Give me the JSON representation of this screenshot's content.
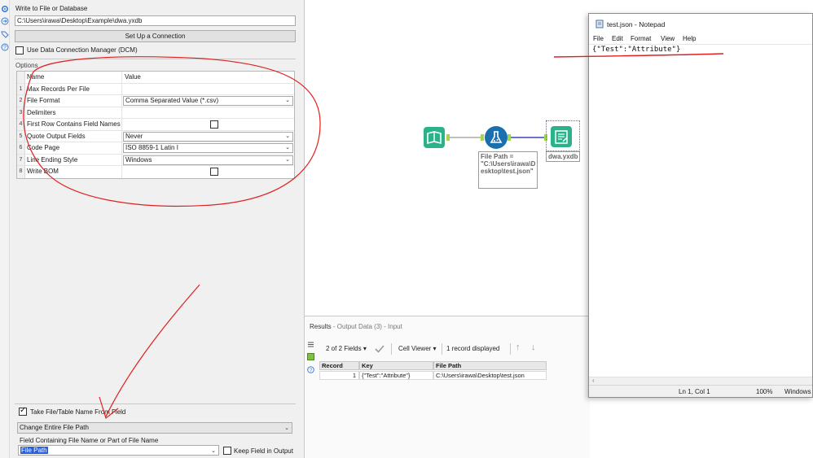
{
  "output_config": {
    "heading": "Write to File or Database",
    "path_value": "C:\\Users\\irawa\\Desktop\\Example\\dwa.yxdb",
    "setup_button": "Set Up a Connection",
    "dcm_label": "Use Data Connection Manager (DCM)",
    "options_label": "Options",
    "grid_headers": {
      "name": "Name",
      "value": "Value"
    },
    "grid_rows": [
      {
        "num": "1",
        "name": "Max Records Per File",
        "value": ""
      },
      {
        "num": "2",
        "name": "File Format",
        "value": "Comma Separated Value (*.csv)"
      },
      {
        "num": "3",
        "name": "Delimiters",
        "value": ""
      },
      {
        "num": "4",
        "name": "First Row Contains Field Names",
        "value": ""
      },
      {
        "num": "5",
        "name": "Quote Output Fields",
        "value": "Never"
      },
      {
        "num": "6",
        "name": "Code Page",
        "value": "ISO 8859-1 Latin I"
      },
      {
        "num": "7",
        "name": "Line Ending Style",
        "value": "Windows"
      },
      {
        "num": "8",
        "name": "Write BOM",
        "value": ""
      }
    ],
    "take_name_label": "Take File/Table Name From Field",
    "change_mode": "Change Entire File Path",
    "field_containing_label": "Field Containing File Name or Part of File Name",
    "field_value": "File Path",
    "keep_field_label": "Keep Field in Output"
  },
  "canvas": {
    "formula_annotation": [
      "File Path =",
      "\"C:\\Users\\irawa\\D",
      "esktop\\test.json\""
    ],
    "output_annotation": "dwa.yxdb"
  },
  "results": {
    "title": "Results",
    "subtitle": "- Output Data (3) - Input",
    "fields_count": "2 of 2 Fields",
    "cell_viewer": "Cell Viewer",
    "records_displayed": "1 record displayed",
    "columns": [
      "Record",
      "Key",
      "File Path"
    ],
    "rows": [
      [
        "1",
        "{\"Test\":\"Attribute\"}",
        "C:\\Users\\irawa\\Desktop\\test.json"
      ]
    ]
  },
  "notepad": {
    "title": "test.json - Notepad",
    "menu": [
      "File",
      "Edit",
      "Format",
      "View",
      "Help"
    ],
    "content": "{\"Test\":\"Attribute\"}",
    "status_position": "Ln 1, Col 1",
    "status_zoom": "100%",
    "status_eol": "Windows"
  },
  "colors": {
    "input_tool": "#2ab38a",
    "formula_tool": "#1a6faf",
    "output_tool": "#2ab38a",
    "annotation_ink": "#e02020",
    "field_highlight": "#2b5fd9"
  }
}
